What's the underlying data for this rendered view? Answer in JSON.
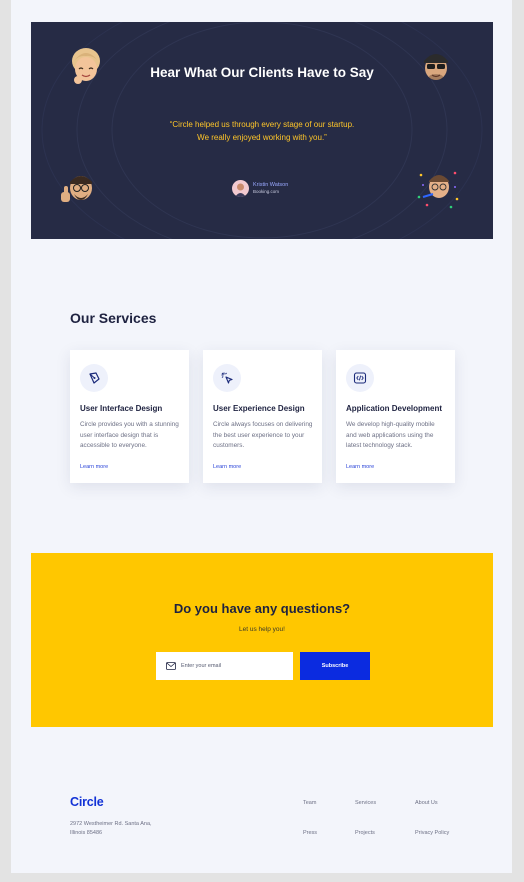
{
  "testimonial": {
    "title": "Hear What Our Clients Have to Say",
    "quote_line1": "“Circle helped us through every stage of our startup.",
    "quote_line2": "We really enjoyed working with you.”",
    "person_name": "Kristin Watson",
    "person_company": "Booking.com",
    "colors": {
      "background": "#262b45",
      "quote": "#ffc629",
      "name": "#9aa9ff"
    }
  },
  "services": {
    "title": "Our Services",
    "cards": [
      {
        "icon": "pen-tool-icon",
        "title": "User Interface Design",
        "description": "Circle provides you with a stunning user interface design that is accessible to everyone.",
        "link": "Learn more"
      },
      {
        "icon": "cursor-click-icon",
        "title": "User Experience Design",
        "description": "Circle always focuses on delivering the best user experience to your customers.",
        "link": "Learn more"
      },
      {
        "icon": "code-icon",
        "title": "Application Development",
        "description": "We develop high-quality mobile and web applications using the latest technology stack.",
        "link": "Learn more"
      }
    ]
  },
  "questions": {
    "title": "Do you have any questions?",
    "subtitle": "Let us help you!",
    "email_placeholder": "Enter your email",
    "email_icon": "mail-icon",
    "subscribe_label": "Subscribe",
    "colors": {
      "background": "#ffc700",
      "button": "#0b2be0"
    }
  },
  "footer": {
    "logo": "Circle",
    "address_line1": "2972 Westheimer Rd. Santa Ana,",
    "address_line2": "Illinois 85486",
    "links": [
      "Team",
      "Services",
      "About Us",
      "Press",
      "Projects",
      "Privacy Policy"
    ],
    "colors": {
      "logo": "#1232d6"
    }
  }
}
